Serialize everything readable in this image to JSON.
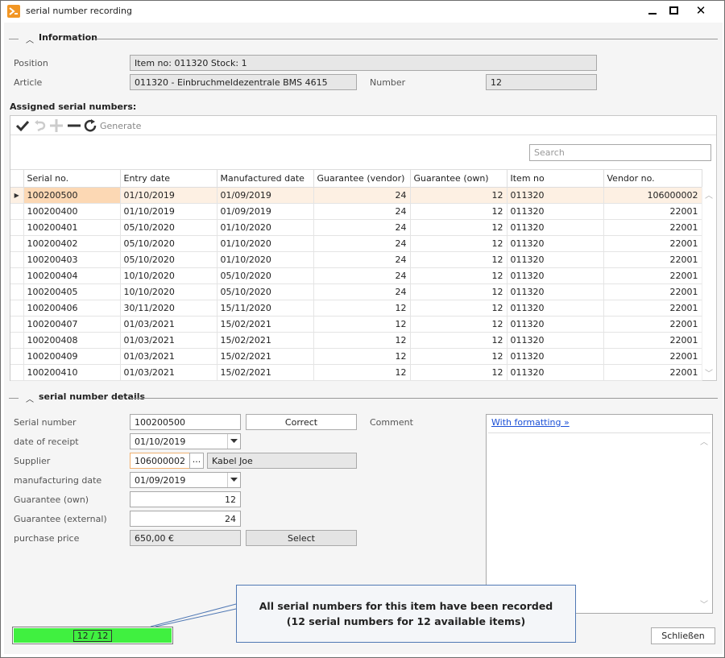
{
  "window": {
    "title": "serial number recording"
  },
  "info": {
    "header": "Information",
    "position_label": "Position",
    "position_value": "Item no: 011320 Stock: 1",
    "article_label": "Article",
    "article_value": "011320 - Einbruchmeldezentrale BMS 4615",
    "number_label": "Number",
    "number_value": "12"
  },
  "assigned": {
    "header": "Assigned serial numbers:",
    "generate_label": "Generate",
    "search_placeholder": "Search",
    "columns": [
      "Serial no.",
      "Entry date",
      "Manufactured date",
      "Guarantee (vendor)",
      "Guarantee (own)",
      "Item no",
      "Vendor no."
    ],
    "rows": [
      [
        "100200500",
        "01/10/2019",
        "01/09/2019",
        "24",
        "12",
        "011320",
        "106000002"
      ],
      [
        "100200400",
        "01/10/2019",
        "01/09/2019",
        "24",
        "12",
        "011320",
        "22001"
      ],
      [
        "100200401",
        "05/10/2020",
        "01/10/2020",
        "24",
        "12",
        "011320",
        "22001"
      ],
      [
        "100200402",
        "05/10/2020",
        "01/10/2020",
        "24",
        "12",
        "011320",
        "22001"
      ],
      [
        "100200403",
        "05/10/2020",
        "01/10/2020",
        "24",
        "12",
        "011320",
        "22001"
      ],
      [
        "100200404",
        "10/10/2020",
        "05/10/2020",
        "24",
        "12",
        "011320",
        "22001"
      ],
      [
        "100200405",
        "10/10/2020",
        "05/10/2020",
        "24",
        "12",
        "011320",
        "22001"
      ],
      [
        "100200406",
        "30/11/2020",
        "15/11/2020",
        "12",
        "12",
        "011320",
        "22001"
      ],
      [
        "100200407",
        "01/03/2021",
        "15/02/2021",
        "12",
        "12",
        "011320",
        "22001"
      ],
      [
        "100200408",
        "01/03/2021",
        "15/02/2021",
        "12",
        "12",
        "011320",
        "22001"
      ],
      [
        "100200409",
        "01/03/2021",
        "15/02/2021",
        "12",
        "12",
        "011320",
        "22001"
      ],
      [
        "100200410",
        "01/03/2021",
        "15/02/2021",
        "12",
        "12",
        "011320",
        "22001"
      ]
    ]
  },
  "details": {
    "header": "serial number details",
    "serial_label": "Serial number",
    "serial_value": "100200500",
    "correct_label": "Correct",
    "comment_label": "Comment",
    "receipt_label": "date of receipt",
    "receipt_value": "01/10/2019",
    "supplier_label": "Supplier",
    "supplier_value": "106000002",
    "supplier_browse": "...",
    "supplier_name": "Kabel Joe",
    "mfg_label": "manufacturing date",
    "mfg_value": "01/09/2019",
    "g_own_label": "Guarantee (own)",
    "g_own_value": "12",
    "g_ext_label": "Guarantee (external)",
    "g_ext_value": "24",
    "price_label": "purchase price",
    "price_value": "650,00 €",
    "select_label": "Select",
    "formatting_link": "With formatting »"
  },
  "footer": {
    "progress_text": "12 / 12",
    "progress_fraction": 1.0,
    "callout_line1": "All serial numbers for this item have been recorded",
    "callout_line2": "(12 serial numbers for 12 available items)",
    "close_label": "Schließen"
  },
  "colors": {
    "selected_row": "#fdf0e3",
    "selected_cell": "#fcd8b4",
    "progress": "#40f040",
    "link": "#1a4fd6",
    "accent": "#f29624"
  }
}
